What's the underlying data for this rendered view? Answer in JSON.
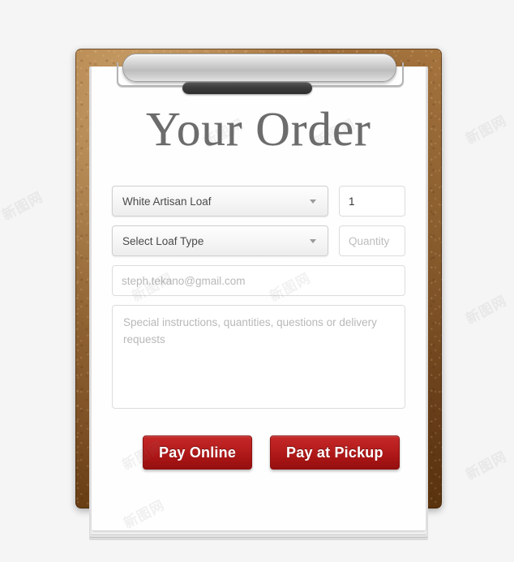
{
  "page": {
    "background_color": "#f5f5f5",
    "watermark_text": "新图网"
  },
  "clipboard": {
    "wood_color_top": "#a8763f",
    "wood_color_bottom": "#62390f",
    "clip": {
      "bar_name": "metal clip bar",
      "grip_name": "clip grip",
      "metal_color": "#d2d2d2",
      "grip_color": "#3c3c3c"
    }
  },
  "form": {
    "title": "Your Order",
    "loaf_select_1": {
      "value": "White Artisan Loaf",
      "caret_icon": "chevron-down-icon"
    },
    "quantity_1": {
      "value": "1",
      "placeholder": "Quantity"
    },
    "loaf_select_2": {
      "value": "Select Loaf Type",
      "caret_icon": "chevron-down-icon"
    },
    "quantity_2": {
      "value": "",
      "placeholder": "Quantity"
    },
    "email": {
      "value": "",
      "placeholder": "steph.tekano@gmail.com"
    },
    "notes": {
      "value": "",
      "placeholder": "Special instructions, quantities, questions or delivery requests"
    },
    "buttons": {
      "pay_online": "Pay Online",
      "pay_at_pickup": "Pay at Pickup",
      "color": "#b81e1e"
    }
  }
}
